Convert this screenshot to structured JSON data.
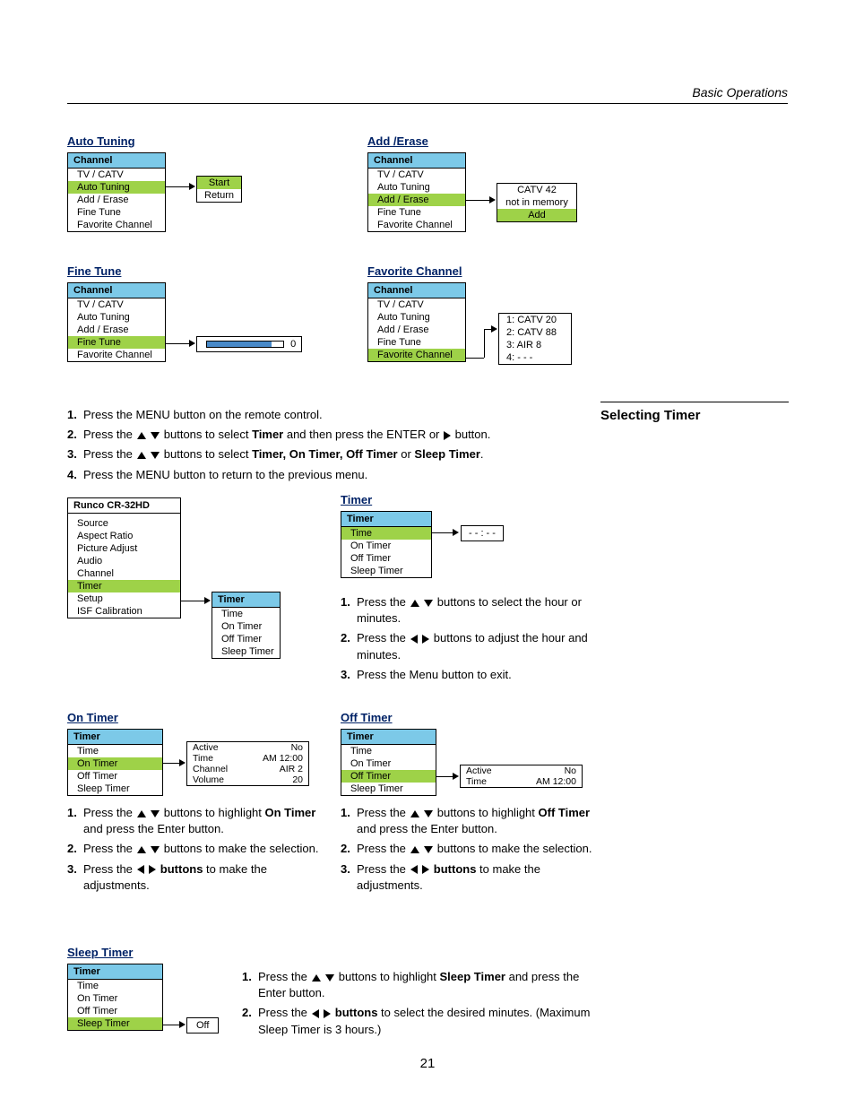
{
  "header": {
    "text": "Basic Operations"
  },
  "page_number": "21",
  "auto_tuning": {
    "heading": "Auto Tuning",
    "menu_title": "Channel",
    "items": [
      "TV / CATV",
      "Auto Tuning",
      "Add / Erase",
      "Fine Tune",
      "Favorite Channel"
    ],
    "popup": [
      "Start",
      "Return"
    ]
  },
  "add_erase": {
    "heading": "Add /Erase",
    "menu_title": "Channel",
    "items": [
      "TV / CATV",
      "Auto Tuning",
      "Add / Erase",
      "Fine Tune",
      "Favorite Channel"
    ],
    "popup": [
      "CATV 42",
      "not in memory",
      "Add"
    ]
  },
  "fine_tune": {
    "heading": "Fine Tune",
    "menu_title": "Channel",
    "items": [
      "TV / CATV",
      "Auto Tuning",
      "Add / Erase",
      "Fine Tune",
      "Favorite Channel"
    ],
    "popup_value": "0"
  },
  "favorite_channel": {
    "heading": "Favorite Channel",
    "menu_title": "Channel",
    "items": [
      "TV / CATV",
      "Auto Tuning",
      "Add / Erase",
      "Fine Tune",
      "Favorite Channel"
    ],
    "popup": [
      "1:  CATV 20",
      "2:  CATV 88",
      "3:  AIR 8",
      "4:  - - -"
    ]
  },
  "main_steps": {
    "s1": "Press the MENU button on the remote control.",
    "s2a": "Press the ",
    "s2b": " buttons to select ",
    "s2_bold": "Timer",
    "s2c": " and then press the ENTER or ",
    "s2d": " button.",
    "s3a": "Press the ",
    "s3b": " buttons to select ",
    "s3_bold": "Timer, On Timer, Off Timer",
    "s3c": " or ",
    "s3_bold2": "Sleep Timer",
    "s3d": ".",
    "s4": "Press the MENU button to return to the previous menu."
  },
  "side_heading": "Selecting Timer",
  "runco": {
    "title": "Runco CR-32HD",
    "items": [
      "Source",
      "Aspect Ratio",
      "Picture Adjust",
      "Audio",
      "Channel",
      "Timer",
      "Setup",
      "ISF Calibration"
    ],
    "popup_title": "Timer",
    "popup_items": [
      "Time",
      "On Timer",
      "Off Timer",
      "Sleep Timer"
    ]
  },
  "timer": {
    "heading": "Timer",
    "menu_title": "Timer",
    "items": [
      "Time",
      "On Timer",
      "Off Timer",
      "Sleep Timer"
    ],
    "popup": "- - : - -",
    "steps": {
      "s1a": "Press the ",
      "s1b": " buttons to select the hour or minutes.",
      "s2a": "Press the ",
      "s2b": " buttons to adjust the hour and minutes.",
      "s3": "Press the Menu button to exit."
    }
  },
  "on_timer": {
    "heading": "On Timer",
    "menu_title": "Timer",
    "items": [
      "Time",
      "On Timer",
      "Off Timer",
      "Sleep Timer"
    ],
    "popup": {
      "k1": "Active",
      "v1": "No",
      "k2": "Time",
      "v2": "AM 12:00",
      "k3": "Channel",
      "v3": "AIR 2",
      "k4": "Volume",
      "v4": "20"
    },
    "steps": {
      "s1a": "Press the ",
      "s1b": " buttons to highlight ",
      "s1_bold": "On Timer",
      "s1c": " and press the Enter button.",
      "s2a": "Press the ",
      "s2b": " buttons to make the selection.",
      "s3a": "Press the ",
      "s3b": " buttons",
      "s3c": " to make the adjustments."
    }
  },
  "off_timer": {
    "heading": "Off Timer",
    "menu_title": "Timer",
    "items": [
      "Time",
      "On Timer",
      "Off Timer",
      "Sleep Timer"
    ],
    "popup": {
      "k1": "Active",
      "v1": "No",
      "k2": "Time",
      "v2": "AM 12:00"
    },
    "steps": {
      "s1a": "Press the ",
      "s1b": " buttons to highlight ",
      "s1_bold": "Off Timer",
      "s1c": " and press the Enter button.",
      "s2a": "Press the ",
      "s2b": " buttons to make the selection.",
      "s3a": "Press the ",
      "s3b": " buttons",
      "s3c": " to make the adjustments."
    }
  },
  "sleep_timer": {
    "heading": "Sleep Timer",
    "menu_title": "Timer",
    "items": [
      "Time",
      "On Timer",
      "Off Timer",
      "Sleep Timer"
    ],
    "popup": "Off",
    "steps": {
      "s1a": "Press the ",
      "s1b": " buttons to highlight ",
      "s1_bold": "Sleep Timer",
      "s1c": " and press the Enter button.",
      "s2a": "Press the ",
      "s2b": " buttons",
      "s2c": " to select the desired minutes. (Maximum Sleep Timer is 3 hours.)"
    }
  }
}
